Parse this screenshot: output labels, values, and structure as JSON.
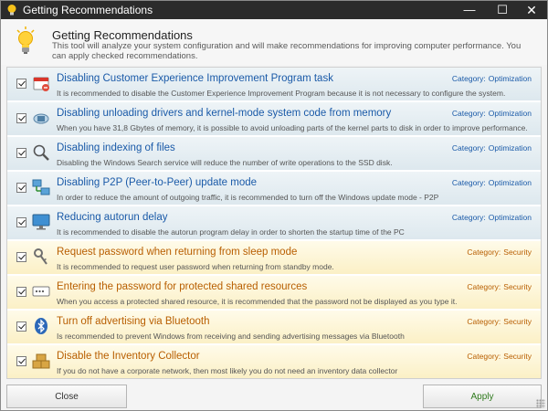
{
  "window": {
    "title": "Getting Recommendations",
    "minimize_glyph": "—",
    "maximize_glyph": "☐",
    "close_glyph": "✕",
    "app_icon": "lightbulb-icon"
  },
  "header": {
    "heading": "Getting Recommendations",
    "description": "This tool will analyze your system configuration and will make recommendations for improving computer performance. You can apply checked recommendations.",
    "icon": "lightbulb-icon"
  },
  "category_prefix": "Category:",
  "items": [
    {
      "title": "Disabling Customer Experience Improvement Program task",
      "description": "It is recommended to disable the Customer Experience Improvement Program because it is not necessary to configure the system.",
      "category": "Optimization",
      "kind": "opt",
      "checked": true,
      "icon": "calendar-task-icon"
    },
    {
      "title": "Disabling unloading drivers and kernel-mode system code from memory",
      "description": "When you have 31,8 Gbytes of memory, it is possible to avoid unloading parts of the kernel parts to disk in order to improve performance.",
      "category": "Optimization",
      "kind": "opt",
      "checked": true,
      "icon": "memory-chip-icon"
    },
    {
      "title": "Disabling indexing of files",
      "description": "Disabling the Windows Search service will reduce the number of write operations to the SSD disk.",
      "category": "Optimization",
      "kind": "opt",
      "checked": true,
      "icon": "magnifier-icon"
    },
    {
      "title": "Disabling P2P (Peer-to-Peer) update mode",
      "description": "In order to reduce the amount of outgoing traffic, it is recommended to turn off the Windows update mode - P2P",
      "category": "Optimization",
      "kind": "opt",
      "checked": true,
      "icon": "network-computers-icon"
    },
    {
      "title": "Reducing autorun delay",
      "description": "It is recommended to disable the autorun program delay in order to shorten the startup time of the PC",
      "category": "Optimization",
      "kind": "opt",
      "checked": true,
      "icon": "monitor-icon"
    },
    {
      "title": "Request password when returning from sleep mode",
      "description": "It is recommended to request user password when returning from standby mode.",
      "category": "Security",
      "kind": "sec",
      "checked": true,
      "icon": "key-icon"
    },
    {
      "title": "Entering the password for protected shared resources",
      "description": "When you access a protected shared resource, it is recommended that the password not be displayed as you type it.",
      "category": "Security",
      "kind": "sec",
      "checked": true,
      "icon": "password-field-icon"
    },
    {
      "title": "Turn off advertising via Bluetooth",
      "description": "Is recommended to prevent Windows from receiving and sending advertising messages via Bluetooth",
      "category": "Security",
      "kind": "sec",
      "checked": true,
      "icon": "bluetooth-icon"
    },
    {
      "title": "Disable the Inventory Collector",
      "description": "If you do not have a corporate network, then most likely you do not need an inventory data collector",
      "category": "Security",
      "kind": "sec",
      "checked": true,
      "icon": "boxes-icon"
    }
  ],
  "footer": {
    "close_label": "Close",
    "apply_label": "Apply"
  },
  "colors": {
    "optimization_text": "#1a5aa8",
    "security_text": "#b85e00",
    "titlebar": "#2b2b2b"
  }
}
